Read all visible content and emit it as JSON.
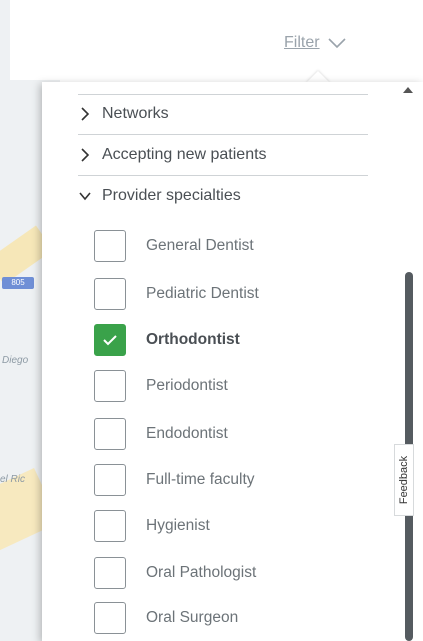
{
  "header": {
    "filter_label": "Filter"
  },
  "panel": {
    "sections": [
      {
        "label": "Networks",
        "expanded": false
      },
      {
        "label": "Accepting new patients",
        "expanded": false
      },
      {
        "label": "Provider specialties",
        "expanded": true
      }
    ],
    "specialties": [
      {
        "label": "General Dentist",
        "checked": false
      },
      {
        "label": "Pediatric Dentist",
        "checked": false
      },
      {
        "label": "Orthodontist",
        "checked": true
      },
      {
        "label": "Periodontist",
        "checked": false
      },
      {
        "label": "Endodontist",
        "checked": false
      },
      {
        "label": "Full-time faculty",
        "checked": false
      },
      {
        "label": "Hygienist",
        "checked": false
      },
      {
        "label": "Oral Pathologist",
        "checked": false
      },
      {
        "label": "Oral Surgeon",
        "checked": false
      }
    ]
  },
  "map": {
    "shield": "805",
    "label_diego": "Diego",
    "label_ric": "el Ric"
  },
  "feedback": {
    "label": "Feedback"
  },
  "colors": {
    "checked": "#3aa24a",
    "text": "#4a4f54",
    "muted": "#6c7378",
    "link": "#9aa3ab"
  }
}
